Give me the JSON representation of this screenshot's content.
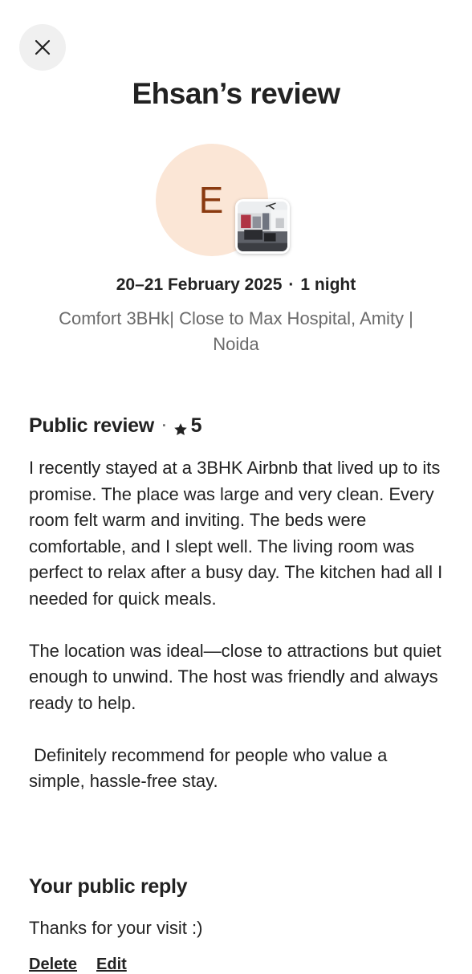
{
  "header": {
    "close_icon": "close-icon",
    "title": "Ehsan’s review"
  },
  "guest": {
    "initial": "E",
    "avatar_color": "#fbe6d6",
    "initial_color": "#8a3a10"
  },
  "stay": {
    "dates": "20–21 February 2025",
    "separator": "·",
    "nights": "1 night",
    "listing_name": "Comfort 3BHk| Close to Max Hospital, Amity | Noida"
  },
  "review": {
    "heading": "Public review",
    "separator": "·",
    "star_icon": "star-icon",
    "rating": "5",
    "body": "I recently stayed at a 3BHK Airbnb that lived up to its promise. The place was large and very clean. Every room felt warm and inviting. The beds were comfortable, and I slept well. The living room was perfect to relax after a busy day. The kitchen had all I needed for quick meals.\n\nThe location was ideal—close to attractions but quiet enough to unwind. The host was friendly and always ready to help.\n\n Definitely recommend for people who value a simple, hassle-free stay."
  },
  "reply": {
    "heading": "Your public reply",
    "text": "Thanks for your visit :)",
    "delete_label": "Delete",
    "edit_label": "Edit"
  }
}
